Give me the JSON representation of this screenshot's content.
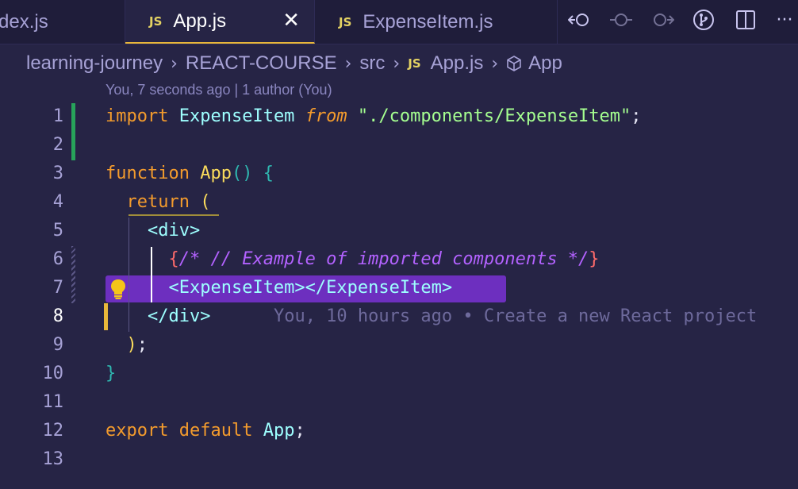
{
  "tabs": [
    {
      "label": "dex.js",
      "active": false
    },
    {
      "label": "App.js",
      "active": true,
      "badge": "JS"
    },
    {
      "label": "ExpenseItem.js",
      "active": false,
      "badge": "JS"
    }
  ],
  "tab_close": "✕",
  "toolbar": {
    "icons": [
      "go-back-icon",
      "commit-icon",
      "go-forward-icon",
      "source-control-icon",
      "split-editor-icon",
      "more-actions-icon"
    ],
    "more": "···"
  },
  "breadcrumb": {
    "items": [
      "learning-journey",
      "REACT-COURSE",
      "src",
      "App.js",
      "App"
    ],
    "separator": "›",
    "file_badge": "JS"
  },
  "blame_header": "You, 7 seconds ago | 1 author (You)",
  "line_numbers": [
    "1",
    "2",
    "3",
    "4",
    "5",
    "6",
    "7",
    "8",
    "9",
    "10",
    "11",
    "12",
    "13"
  ],
  "active_line": "8",
  "code": {
    "l1": {
      "kw": "import",
      "id": "ExpenseItem",
      "from": "from",
      "str": "\"./components/ExpenseItem\"",
      "end": ";"
    },
    "l3": {
      "kw": "function",
      "fn": "App",
      "paren": "()",
      "brace": "{"
    },
    "l4": {
      "kw": "return",
      "paren": "("
    },
    "l5": {
      "tag": "<div>"
    },
    "l6": {
      "open": "{",
      "comment": "/* // Example of imported components */",
      "close": "}"
    },
    "l7": {
      "tag": "<ExpenseItem></ExpenseItem>"
    },
    "l8": {
      "tag": "</div>",
      "blame": "You, 10 hours ago • Create a new React project"
    },
    "l9": {
      "paren": ")",
      "end": ";"
    },
    "l10": {
      "brace": "}"
    },
    "l12": {
      "kw1": "export",
      "kw2": "default",
      "id": "App",
      "end": ";"
    }
  },
  "colors": {
    "background": "#262445",
    "added_line": "#27a35a",
    "modified_line": "#e8b73a",
    "selection": "#6d2fbf"
  }
}
